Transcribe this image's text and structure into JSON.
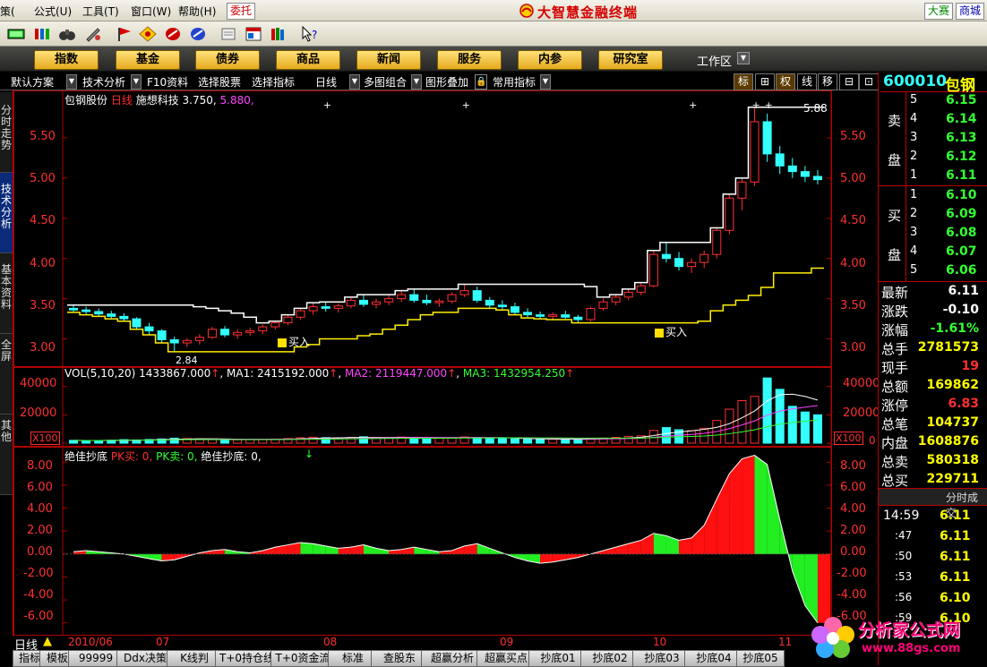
{
  "menu": {
    "items": [
      "策(",
      "公式(U)",
      "工具(T)",
      "窗口(W)",
      "帮助(H)"
    ],
    "weituo": "委托",
    "app_title": "大智慧金融终端",
    "right_buttons": [
      "大赛",
      "商城"
    ]
  },
  "nav": {
    "buttons": [
      "指数",
      "基金",
      "债券",
      "商品",
      "新闻",
      "服务",
      "内参",
      "研究室"
    ],
    "workspace": "工作区"
  },
  "chart_toolbar": {
    "items": [
      "默认方案",
      "技术分析",
      "F10资料",
      "选择股票",
      "选择指标",
      "日线",
      "多图组合",
      "图形叠加",
      "常用指标"
    ],
    "right_buttons": [
      "标",
      "⊞",
      "权",
      "线",
      "移",
      "⊟",
      "⊡"
    ]
  },
  "left_tabs": [
    "分时走势",
    "技术分析",
    "基本资料",
    "全屏",
    "其他"
  ],
  "price_chart": {
    "stock_name": "包钢股份",
    "period": "日线",
    "indicator_label": "施想科技",
    "low_value": "3.750,",
    "high_value": "5.880,",
    "peak_label": "5.88",
    "low_label": "2.84",
    "buy_label": "买入",
    "y_ticks": [
      "5.50",
      "5.00",
      "4.50",
      "4.00",
      "3.50",
      "3.00"
    ]
  },
  "volume_chart": {
    "label": "VOL(5,10,20)",
    "vol": "1433867.000",
    "ma1_label": "MA1:",
    "ma1": "2415192.000",
    "ma2_label": "MA2:",
    "ma2": "2119447.000",
    "ma3_label": "MA3:",
    "ma3": "1432954.250",
    "y_ticks": [
      "40000",
      "20000",
      "0"
    ],
    "unit": "X100"
  },
  "indicator_chart": {
    "name": "绝佳抄底",
    "pk_buy": "PK买: 0,",
    "pk_sell": "PK卖: 0,",
    "jj": "绝佳抄底: 0,",
    "y_ticks": [
      "8.00",
      "6.00",
      "4.00",
      "2.00",
      "0.00",
      "-2.00",
      "-4.00",
      "-6.00"
    ]
  },
  "bottom": {
    "period_label": "日线",
    "dates": [
      "2010/06",
      "07",
      "08",
      "09",
      "10",
      "11"
    ],
    "tabs": [
      "指标",
      "模板",
      "99999",
      "Ddx决策",
      "K线判",
      "T+0持仓线",
      "T+0资金流",
      "标准",
      "查股东",
      "超赢分析",
      "超赢买点",
      "抄底01",
      "抄底02",
      "抄底03",
      "抄底04",
      "抄底05"
    ]
  },
  "quote_panel": {
    "code": "600010",
    "name": "包钢",
    "sell_label": [
      "卖",
      "盘"
    ],
    "buy_label": [
      "买",
      "盘"
    ],
    "asks": [
      {
        "level": "5",
        "price": "6.15"
      },
      {
        "level": "4",
        "price": "6.14"
      },
      {
        "level": "3",
        "price": "6.13"
      },
      {
        "level": "2",
        "price": "6.12"
      },
      {
        "level": "1",
        "price": "6.11"
      }
    ],
    "bids": [
      {
        "level": "1",
        "price": "6.10"
      },
      {
        "level": "2",
        "price": "6.09"
      },
      {
        "level": "3",
        "price": "6.08"
      },
      {
        "level": "4",
        "price": "6.07"
      },
      {
        "level": "5",
        "price": "6.06"
      }
    ],
    "stats": [
      {
        "label": "最新",
        "value": "6.11",
        "color": "#ffffff"
      },
      {
        "label": "涨跌",
        "value": "-0.10",
        "color": "#ffffff"
      },
      {
        "label": "涨幅",
        "value": "-1.61%",
        "color": "#33ff33"
      },
      {
        "label": "总手",
        "value": "2781573",
        "color": "#ffff00"
      },
      {
        "label": "现手",
        "value": "19",
        "color": "#ff3030"
      },
      {
        "label": "总额",
        "value": "169862",
        "color": "#ffff00"
      },
      {
        "label": "涨停",
        "value": "6.83",
        "color": "#ff3030"
      },
      {
        "label": "总笔",
        "value": "104737",
        "color": "#ffff00"
      },
      {
        "label": "内盘",
        "value": "1608876",
        "color": "#ffff00"
      },
      {
        "label": "总卖",
        "value": "580318",
        "color": "#ffff00"
      },
      {
        "label": "总买",
        "value": "229711",
        "color": "#ffff00"
      }
    ],
    "ticks_header": "分时成交",
    "ticks": [
      {
        "time": "14:59",
        "price": "6.11"
      },
      {
        "time": ":47",
        "price": "6.11"
      },
      {
        "time": ":50",
        "price": "6.11"
      },
      {
        "time": ":53",
        "price": "6.11"
      },
      {
        "time": ":56",
        "price": "6.10"
      },
      {
        "time": ":59",
        "price": "6.10"
      }
    ]
  },
  "watermark": {
    "title": "分析家公式网",
    "url": "www.88gs.com"
  },
  "chart_data": {
    "type": "candlestick",
    "title": "包钢股份 日线",
    "price_ylim": [
      2.75,
      6.0
    ],
    "price_ticks": [
      3.0,
      3.5,
      4.0,
      4.5,
      5.0,
      5.5
    ],
    "x_labels": [
      "2010/06",
      "07",
      "08",
      "09",
      "10",
      "11"
    ],
    "candles": [
      [
        3.38,
        3.42,
        3.33,
        3.36
      ],
      [
        3.36,
        3.4,
        3.3,
        3.34
      ],
      [
        3.34,
        3.38,
        3.28,
        3.31
      ],
      [
        3.31,
        3.35,
        3.25,
        3.28
      ],
      [
        3.28,
        3.32,
        3.22,
        3.25
      ],
      [
        3.25,
        3.27,
        3.12,
        3.15
      ],
      [
        3.15,
        3.2,
        3.05,
        3.1
      ],
      [
        3.1,
        3.12,
        2.95,
        2.99
      ],
      [
        2.99,
        3.03,
        2.84,
        2.95
      ],
      [
        2.95,
        3.01,
        2.9,
        2.98
      ],
      [
        2.98,
        3.06,
        2.93,
        3.02
      ],
      [
        3.02,
        3.15,
        3.0,
        3.12
      ],
      [
        3.12,
        3.16,
        3.02,
        3.05
      ],
      [
        3.05,
        3.12,
        3.0,
        3.08
      ],
      [
        3.08,
        3.14,
        3.04,
        3.1
      ],
      [
        3.1,
        3.18,
        3.06,
        3.15
      ],
      [
        3.15,
        3.22,
        3.12,
        3.2
      ],
      [
        3.2,
        3.3,
        3.17,
        3.27
      ],
      [
        3.27,
        3.38,
        3.24,
        3.35
      ],
      [
        3.35,
        3.45,
        3.3,
        3.4
      ],
      [
        3.4,
        3.46,
        3.34,
        3.38
      ],
      [
        3.38,
        3.44,
        3.33,
        3.41
      ],
      [
        3.41,
        3.52,
        3.38,
        3.48
      ],
      [
        3.48,
        3.55,
        3.4,
        3.43
      ],
      [
        3.43,
        3.5,
        3.38,
        3.46
      ],
      [
        3.46,
        3.55,
        3.42,
        3.5
      ],
      [
        3.5,
        3.6,
        3.46,
        3.55
      ],
      [
        3.55,
        3.62,
        3.45,
        3.48
      ],
      [
        3.48,
        3.55,
        3.42,
        3.45
      ],
      [
        3.45,
        3.5,
        3.4,
        3.47
      ],
      [
        3.47,
        3.58,
        3.44,
        3.55
      ],
      [
        3.55,
        3.68,
        3.52,
        3.6
      ],
      [
        3.6,
        3.65,
        3.45,
        3.48
      ],
      [
        3.48,
        3.52,
        3.38,
        3.42
      ],
      [
        3.42,
        3.48,
        3.36,
        3.4
      ],
      [
        3.4,
        3.45,
        3.3,
        3.33
      ],
      [
        3.33,
        3.38,
        3.26,
        3.3
      ],
      [
        3.3,
        3.34,
        3.25,
        3.28
      ],
      [
        3.28,
        3.33,
        3.24,
        3.3
      ],
      [
        3.3,
        3.35,
        3.25,
        3.27
      ],
      [
        3.27,
        3.3,
        3.2,
        3.24
      ],
      [
        3.24,
        3.4,
        3.22,
        3.38
      ],
      [
        3.38,
        3.5,
        3.35,
        3.46
      ],
      [
        3.46,
        3.55,
        3.42,
        3.52
      ],
      [
        3.52,
        3.62,
        3.48,
        3.58
      ],
      [
        3.58,
        3.7,
        3.54,
        3.66
      ],
      [
        3.66,
        4.1,
        3.64,
        4.05
      ],
      [
        4.05,
        4.2,
        3.95,
        4.0
      ],
      [
        4.0,
        4.08,
        3.85,
        3.9
      ],
      [
        3.9,
        4.0,
        3.82,
        3.95
      ],
      [
        3.95,
        4.1,
        3.88,
        4.05
      ],
      [
        4.05,
        4.38,
        4.0,
        4.35
      ],
      [
        4.35,
        4.8,
        4.3,
        4.75
      ],
      [
        4.75,
        5.0,
        4.6,
        4.95
      ],
      [
        4.95,
        5.88,
        4.9,
        5.7
      ],
      [
        5.7,
        5.8,
        5.2,
        5.3
      ],
      [
        5.3,
        5.4,
        5.05,
        5.15
      ],
      [
        5.15,
        5.25,
        5.0,
        5.08
      ],
      [
        5.08,
        5.15,
        4.95,
        5.02
      ],
      [
        5.02,
        5.1,
        4.92,
        4.98
      ]
    ],
    "volume_ylim": [
      0,
      48000
    ],
    "volume_ticks": [
      0,
      20000,
      40000
    ],
    "volume": [
      2000,
      1800,
      1900,
      2100,
      2500,
      2300,
      2600,
      3000,
      3500,
      3200,
      3000,
      2800,
      2600,
      2400,
      2500,
      2700,
      2900,
      3300,
      3800,
      4200,
      3900,
      3600,
      4100,
      4500,
      4000,
      3800,
      4300,
      3900,
      3700,
      3500,
      3900,
      4400,
      4000,
      3600,
      3300,
      3000,
      2800,
      2700,
      2900,
      2800,
      2600,
      3200,
      3600,
      4100,
      4800,
      5200,
      9000,
      11000,
      9500,
      8800,
      10500,
      16000,
      24000,
      30000,
      33000,
      46000,
      38000,
      26000,
      22000,
      20000
    ],
    "indicator_ylim": [
      -6.8,
      8.8
    ],
    "indicator_ticks": [
      -6,
      -4,
      -2,
      0,
      2,
      4,
      6,
      8
    ],
    "indicator": [
      0.2,
      0.3,
      0.2,
      0.1,
      0.0,
      -0.2,
      -0.4,
      -0.6,
      -0.5,
      -0.2,
      0.1,
      0.3,
      0.4,
      0.2,
      0.1,
      0.3,
      0.6,
      0.8,
      1.0,
      0.9,
      0.7,
      0.5,
      0.6,
      0.8,
      0.5,
      0.3,
      0.4,
      0.6,
      0.4,
      0.2,
      0.3,
      0.7,
      0.9,
      0.5,
      0.1,
      -0.3,
      -0.6,
      -0.8,
      -0.7,
      -0.5,
      -0.3,
      0.0,
      0.3,
      0.6,
      0.9,
      1.2,
      1.8,
      1.6,
      1.2,
      1.4,
      2.5,
      4.8,
      7.0,
      8.3,
      8.6,
      7.8,
      3.0,
      -1.5,
      -4.5,
      -6.0
    ]
  }
}
